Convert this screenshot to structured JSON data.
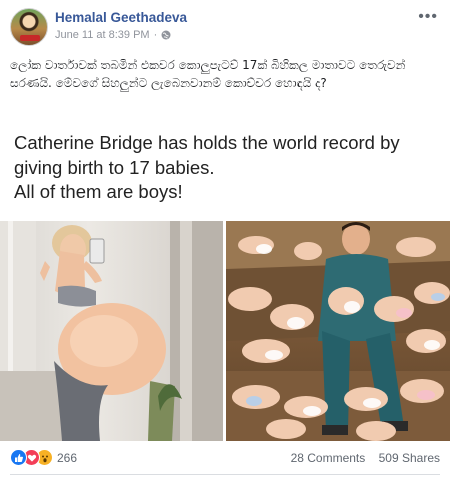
{
  "post": {
    "author": "Hemalal Geethadeva",
    "date": "June 11 at 8:39 PM",
    "separator": "·",
    "privacy_icon": "globe-icon",
    "more_label": "•••",
    "text": "ලෝක වාර්තාවක් තබමින් එකවර කොලුපැටව් 17ක් බිහිකල මාතාවට තෙරුවන් සරණයි. මේවගේ සිහලුන්ට ලැබෙනවානම් කොච්චර හොඳයි ද?"
  },
  "image_text": {
    "lines": [
      "Catherine Bridge has holds the world record by",
      "giving birth to 17 babies.",
      "All of them are boys!"
    ]
  },
  "engagement": {
    "reaction_icons": [
      "like-icon",
      "love-icon",
      "wow-icon"
    ],
    "reaction_count": "266",
    "comments": "28 Comments",
    "shares": "509 Shares"
  },
  "colors": {
    "author_link": "#385898",
    "meta_text": "#90949c",
    "like": "#1877f2",
    "love": "#f33e58",
    "wow": "#f7b125"
  }
}
